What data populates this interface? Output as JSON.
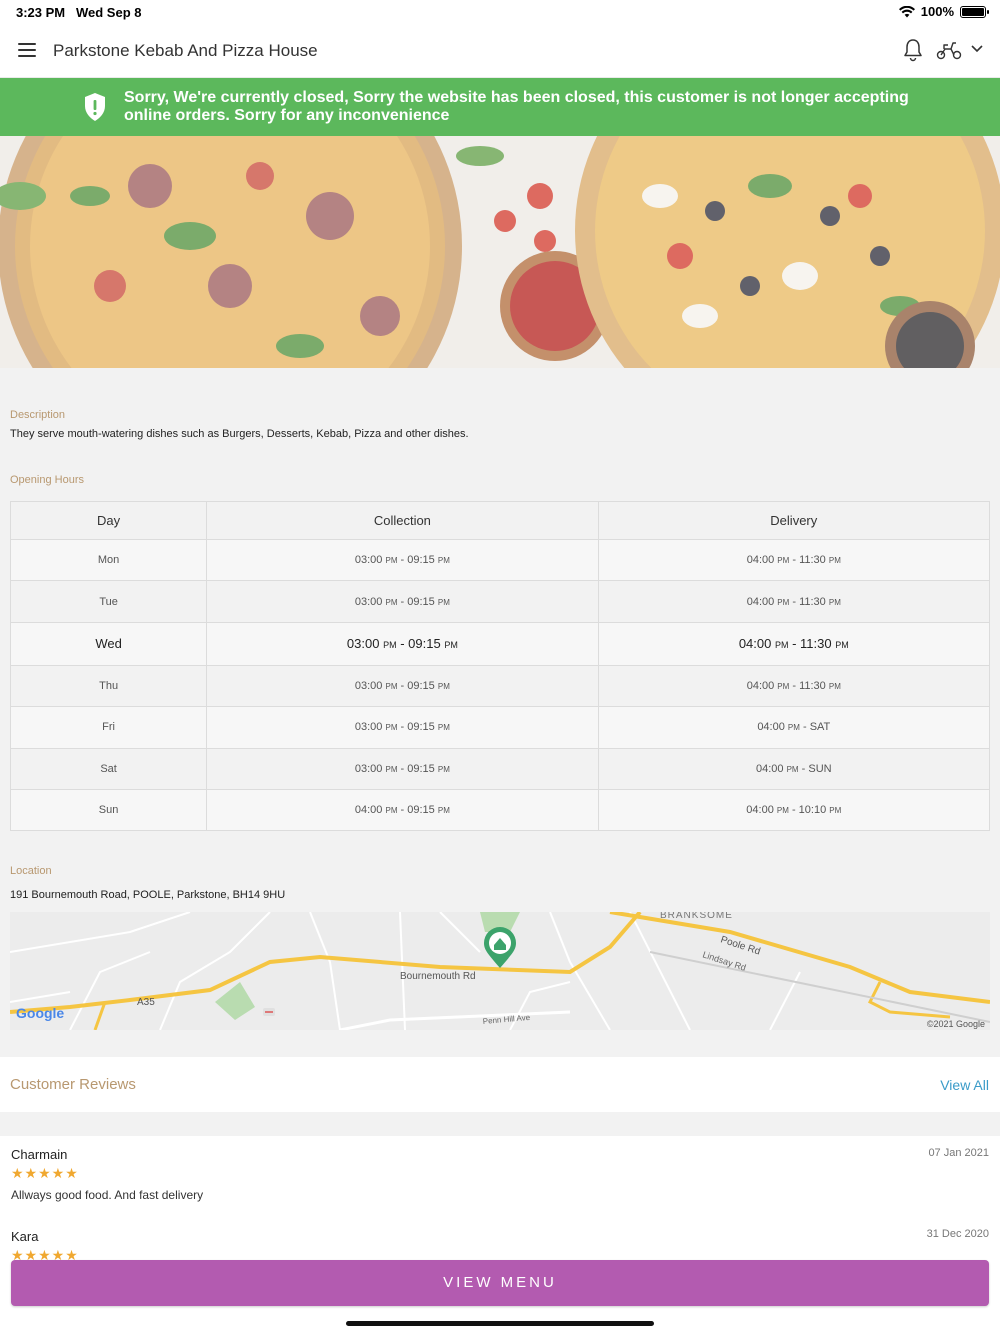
{
  "status_bar": {
    "time": "3:23 PM",
    "date": "Wed Sep 8",
    "battery": "100%"
  },
  "header": {
    "title": "Parkstone Kebab And Pizza House",
    "icons": [
      "menu-icon",
      "bell-icon",
      "scooter-icon",
      "chevron-down-icon"
    ]
  },
  "banner": {
    "text": "Sorry, We're currently closed, Sorry the website has been closed, this customer is not longer accepting online orders. Sorry for any inconvenience",
    "color": "#5cb85c"
  },
  "description": {
    "label": "Description",
    "text": "They serve mouth-watering dishes such as Burgers, Desserts, Kebab, Pizza and other dishes."
  },
  "opening_hours": {
    "label": "Opening Hours",
    "headers": [
      "Day",
      "Collection",
      "Delivery"
    ],
    "rows": [
      {
        "day": "Mon",
        "c_start": "03:00",
        "c_end": "09:15",
        "d_start": "04:00",
        "d_end": "11:30",
        "d_end_ampm": "PM"
      },
      {
        "day": "Tue",
        "c_start": "03:00",
        "c_end": "09:15",
        "d_start": "04:00",
        "d_end": "11:30",
        "d_end_ampm": "PM"
      },
      {
        "day": "Wed",
        "c_start": "03:00",
        "c_end": "09:15",
        "d_start": "04:00",
        "d_end": "11:30",
        "d_end_ampm": "PM"
      },
      {
        "day": "Thu",
        "c_start": "03:00",
        "c_end": "09:15",
        "d_start": "04:00",
        "d_end": "11:30",
        "d_end_ampm": "PM"
      },
      {
        "day": "Fri",
        "c_start": "03:00",
        "c_end": "09:15",
        "d_start": "04:00",
        "d_end": "SAT",
        "d_end_ampm": ""
      },
      {
        "day": "Sat",
        "c_start": "03:00",
        "c_end": "09:15",
        "d_start": "04:00",
        "d_end": "SUN",
        "d_end_ampm": ""
      },
      {
        "day": "Sun",
        "c_start": "04:00",
        "c_end": "09:15",
        "d_start": "04:00",
        "d_end": "10:10",
        "d_end_ampm": "PM"
      }
    ],
    "ampm": "PM"
  },
  "location": {
    "label": "Location",
    "address": "191 Bournemouth Road, POOLE, Parkstone, BH14 9HU",
    "map": {
      "labels": [
        "BRANKSOME",
        "Poole Rd",
        "Lindsay Rd",
        "Bournemouth Rd",
        "A35",
        "Penn Hill Ave"
      ],
      "logo": "Google",
      "copyright": "©2021 Google"
    }
  },
  "reviews": {
    "title": "Customer Reviews",
    "view_all": "View All",
    "items": [
      {
        "name": "Charmain",
        "date": "07 Jan 2021",
        "stars": "★★★★★",
        "rating": 5,
        "text": "Allways good food. And fast delivery"
      },
      {
        "name": "Kara",
        "date": "31 Dec 2020",
        "stars": "★★★★★",
        "rating": 5,
        "text": ""
      }
    ]
  },
  "view_menu_label": "VIEW MENU"
}
